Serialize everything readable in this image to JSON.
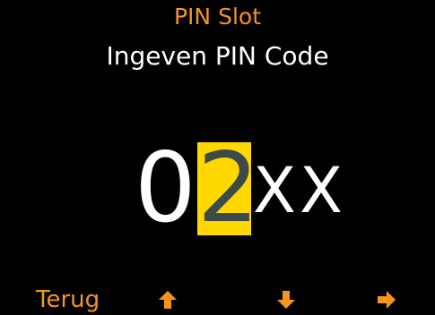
{
  "header": {
    "title": "PIN Slot",
    "subtitle": "Ingeven PIN Code"
  },
  "pin": {
    "digits": [
      "0",
      "2",
      "X",
      "X"
    ],
    "active_index": 1
  },
  "footer": {
    "back_label": "Terug",
    "icons": [
      "arrow-up-icon",
      "arrow-down-icon",
      "arrow-right-icon"
    ]
  },
  "colors": {
    "accent": "#f7941d",
    "highlight": "#ffd800",
    "active_digit": "#3c4a4a",
    "text": "#ffffff",
    "background": "#000000"
  }
}
